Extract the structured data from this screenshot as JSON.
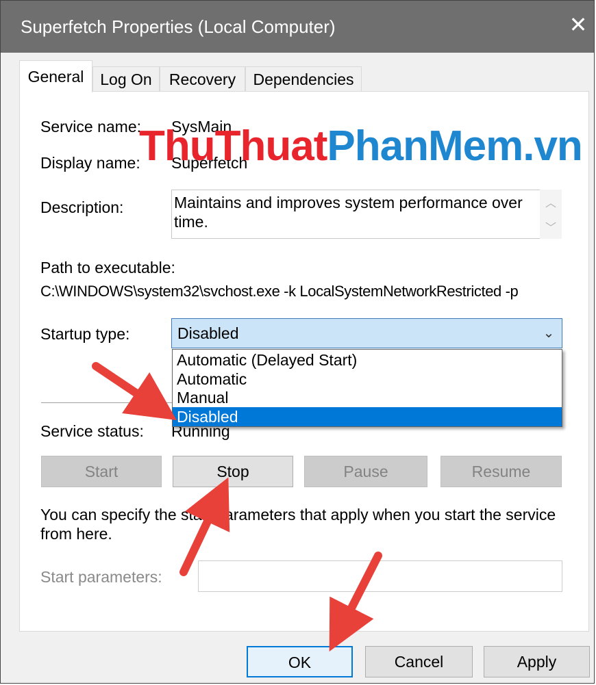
{
  "window": {
    "title": "Superfetch Properties (Local Computer)",
    "close_icon": "close-icon"
  },
  "tabs": [
    {
      "label": "General",
      "active": true
    },
    {
      "label": "Log On"
    },
    {
      "label": "Recovery"
    },
    {
      "label": "Dependencies"
    }
  ],
  "general": {
    "service_name_label": "Service name:",
    "service_name_value": "SysMain",
    "display_name_label": "Display name:",
    "display_name_value": "Superfetch",
    "description_label": "Description:",
    "description_value": "Maintains and improves system performance over time.",
    "path_label": "Path to executable:",
    "path_value": "C:\\WINDOWS\\system32\\svchost.exe -k LocalSystemNetworkRestricted -p",
    "startup_type_label": "Startup type:",
    "startup_type_value": "Disabled",
    "startup_options": [
      "Automatic (Delayed Start)",
      "Automatic",
      "Manual",
      "Disabled"
    ],
    "service_status_label": "Service status:",
    "service_status_value": "Running",
    "buttons": {
      "start": "Start",
      "stop": "Stop",
      "pause": "Pause",
      "resume": "Resume"
    },
    "hint_text": "You can specify the start parameters that apply when you start the service from here.",
    "start_params_label": "Start parameters:",
    "start_params_value": ""
  },
  "footer": {
    "ok": "OK",
    "cancel": "Cancel",
    "apply": "Apply"
  },
  "watermark": {
    "part1": "ThuThuat",
    "part2": "PhanMem",
    "part3": ".vn"
  },
  "colors": {
    "titlebar": "#6f6f6f",
    "selection": "#0078d7",
    "combo_bg": "#cce4f7",
    "arrow": "#e8413a"
  }
}
